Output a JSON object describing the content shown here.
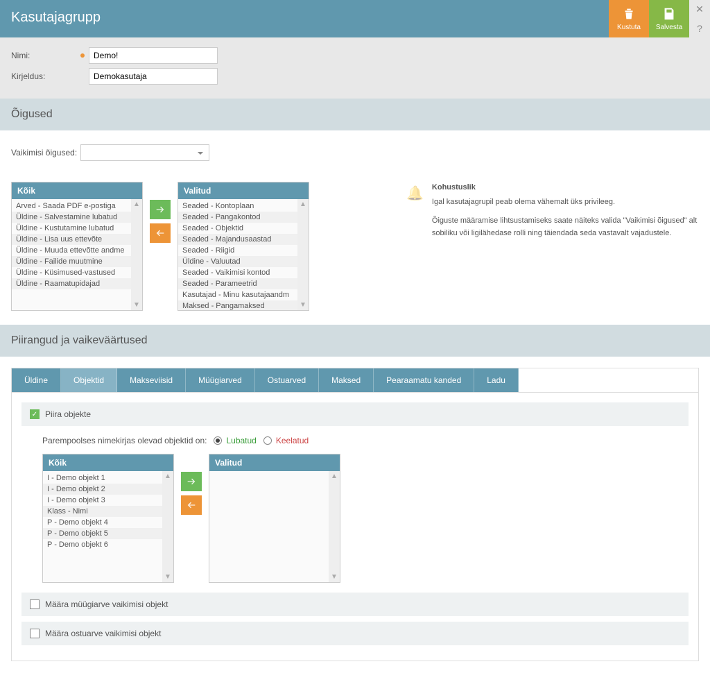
{
  "header": {
    "title": "Kasutajagrupp",
    "delete_label": "Kustuta",
    "save_label": "Salvesta",
    "close_symbol": "✕",
    "help_symbol": "?"
  },
  "form": {
    "name_label": "Nimi:",
    "name_value": "Demo!",
    "desc_label": "Kirjeldus:",
    "desc_value": "Demokasutaja"
  },
  "rights": {
    "section_title": "Õigused",
    "default_label": "Vaikimisi õigused:",
    "all_header": "Kõik",
    "selected_header": "Valitud",
    "all_items": [
      "Arved - Saada PDF e-postiga",
      "Üldine - Salvestamine lubatud",
      "Üldine - Kustutamine lubatud",
      "Üldine - Lisa uus ettevõte",
      "Üldine - Muuda ettevõtte andme",
      "Üldine - Failide muutmine",
      "Üldine - Küsimused-vastused",
      "Üldine - Raamatupidajad"
    ],
    "selected_items": [
      "Seaded - Kontoplaan",
      "Seaded - Pangakontod",
      "Seaded - Objektid",
      "Seaded - Majandusaastad",
      "Seaded - Riigid",
      "Üldine - Valuutad",
      "Seaded - Vaikimisi kontod",
      "Seaded - Parameetrid",
      "Kasutajad - Minu kasutajaandm",
      "Maksed - Pangamaksed"
    ],
    "info_title": "Kohustuslik",
    "info_line1": "Igal kasutajagrupil peab olema vähemalt üks privileeg.",
    "info_line2": "Õiguste määramise lihtsustamiseks saate näiteks valida \"Vaikimisi õigused\" alt sobiliku või ligilähedase rolli ning täiendada seda vastavalt vajadustele."
  },
  "restrictions": {
    "section_title": "Piirangud ja vaikeväärtused",
    "tabs": [
      "Üldine",
      "Objektid",
      "Makseviisid",
      "Müügiarved",
      "Ostuarved",
      "Maksed",
      "Pearaamatu kanded",
      "Ladu"
    ],
    "active_tab": 1,
    "limit_objects_label": "Piira objekte",
    "radio_prefix": "Parempoolses nimekirjas olevad objektid on:",
    "radio_allowed": "Lubatud",
    "radio_denied": "Keelatud",
    "all_header": "Kõik",
    "selected_header": "Valitud",
    "obj_items": [
      "I - Demo objekt 1",
      "I - Demo objekt 2",
      "I - Demo objekt 3",
      "Klass - Nimi",
      "P - Demo objekt 4",
      "P - Demo objekt 5",
      "P - Demo objekt 6"
    ],
    "set_sales_label": "Määra müügiarve vaikimisi objekt",
    "set_purchase_label": "Määra ostuarve vaikimisi objekt"
  }
}
